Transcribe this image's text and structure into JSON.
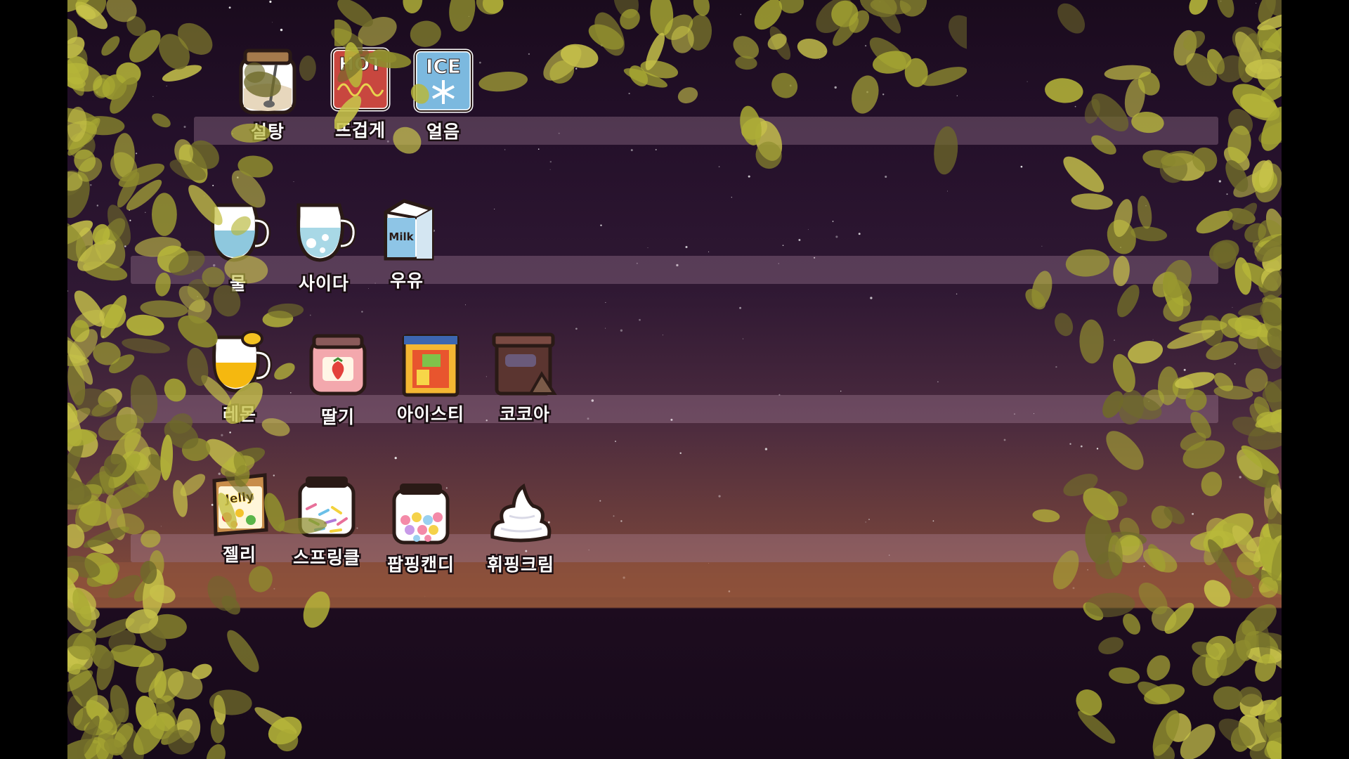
{
  "ingredients": [
    {
      "label": "설탕",
      "icon": "sugar-jar-icon"
    },
    {
      "label": "뜨겁게",
      "icon": "hot-card-icon",
      "card_text": "HOT"
    },
    {
      "label": "얼음",
      "icon": "ice-card-icon",
      "card_text": "ICE"
    },
    {
      "label": "물",
      "icon": "water-pitcher-icon"
    },
    {
      "label": "사이다",
      "icon": "cider-pitcher-icon"
    },
    {
      "label": "우유",
      "icon": "milk-carton-icon",
      "card_text": "Milk"
    },
    {
      "label": "레몬",
      "icon": "lemon-pitcher-icon"
    },
    {
      "label": "딸기",
      "icon": "strawberry-jam-icon"
    },
    {
      "label": "아이스티",
      "icon": "iced-tea-pack-icon"
    },
    {
      "label": "코코아",
      "icon": "cocoa-jar-icon"
    },
    {
      "label": "젤리",
      "icon": "jelly-bag-icon",
      "card_text": "Jelly"
    },
    {
      "label": "스프링클",
      "icon": "sprinkles-jar-icon"
    },
    {
      "label": "팝핑캔디",
      "icon": "popping-candy-jar-icon"
    },
    {
      "label": "휘핑크림",
      "icon": "whipped-cream-icon"
    }
  ],
  "colors": {
    "sky_top": "#1a0b1d",
    "sky_bottom": "#8a5038",
    "shelf": "#a88aa0",
    "leaf_light": "#b8b83a",
    "leaf_dark": "#6f6a2a"
  }
}
